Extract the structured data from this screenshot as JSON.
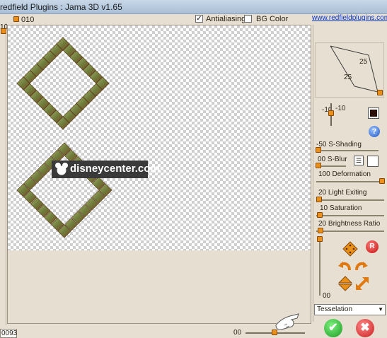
{
  "window": {
    "title": "redfield Plugins : Jama 3D  v1.65"
  },
  "top_bar": {
    "value": "010",
    "antialiasing_label": "Antialiasing",
    "antialiasing_checked": true,
    "bg_color_label": "BG Color",
    "bg_color_checked": false,
    "link_text": "www.redfieldplugins.com"
  },
  "left_ruler": {
    "value": "10"
  },
  "watermark": {
    "text": "disneycenter.com"
  },
  "bottom_bar": {
    "field_value": "0093",
    "zoom_value": "00"
  },
  "shape_preview": {
    "angle_top": "25",
    "angle_bottom": "25"
  },
  "rotation": {
    "value_a": "-10",
    "value_b": "-10"
  },
  "sliders": [
    {
      "value": "-50",
      "label": "S-Shading",
      "level": 0.0
    },
    {
      "value": "00",
      "label": "S-Blur",
      "level": 0.0
    },
    {
      "value": "100",
      "label": "Deformation",
      "level": 1.0
    },
    {
      "value": "20",
      "label": "Light Exiting",
      "level": 0.0
    },
    {
      "value": "10",
      "label": "Saturation",
      "level": 0.0
    },
    {
      "value": "20",
      "label": "Brightness Ratio",
      "level": 0.0
    }
  ],
  "vertical_slider": {
    "value": "00"
  },
  "buttons": {
    "help": "?",
    "reset": "R",
    "ok": "✔",
    "cancel": "✖"
  },
  "tile_select": {
    "selected": "Tesselation"
  },
  "colors": {
    "swatch": "#2a0f0a",
    "accent_handle": "#e8901a",
    "frame_green": "#7d8a4a",
    "frame_brown": "#7a4a24"
  }
}
